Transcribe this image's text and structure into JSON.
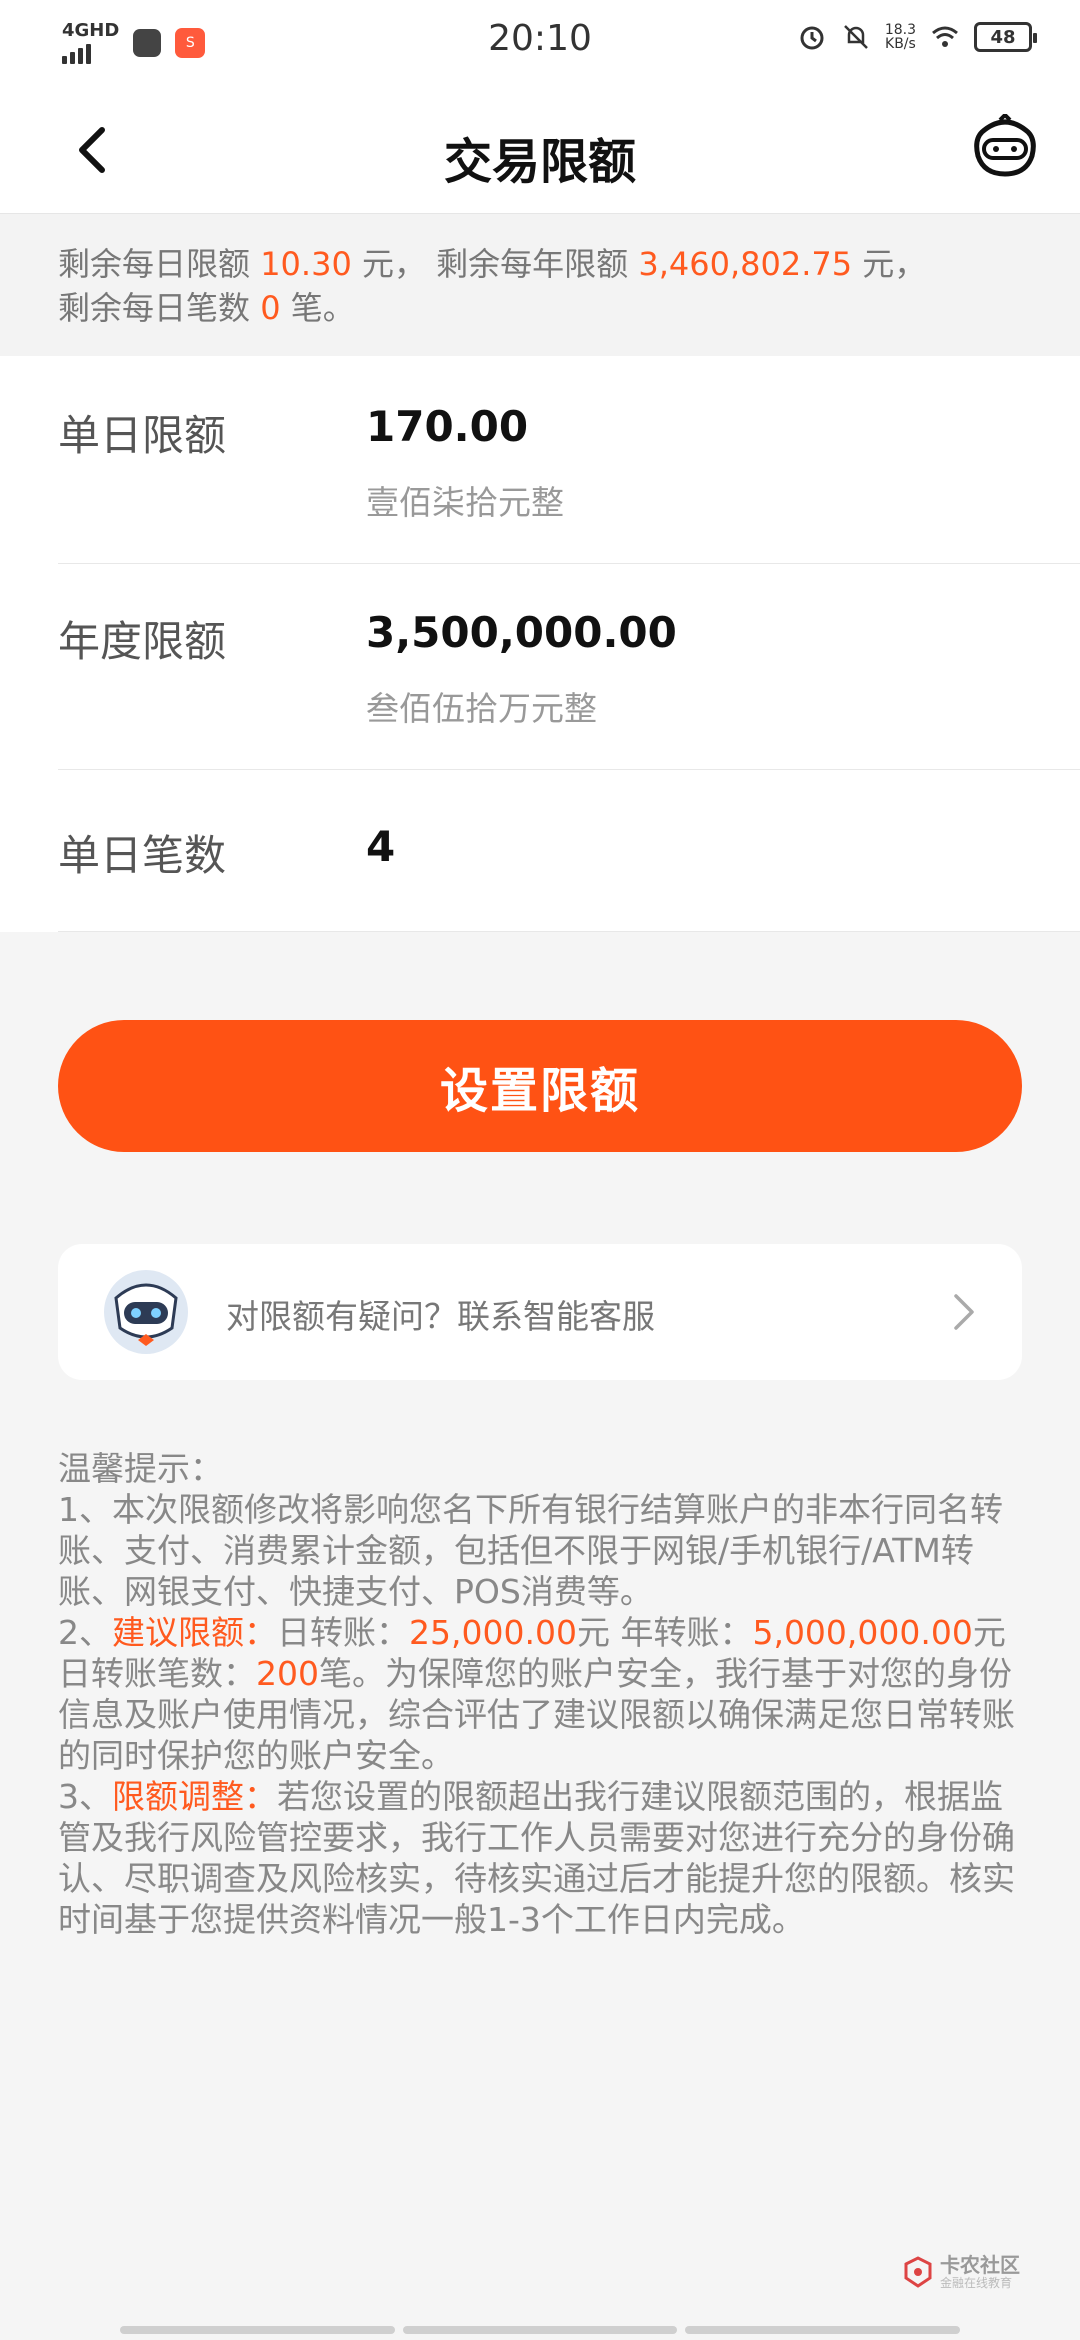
{
  "status_bar": {
    "network": "4GHD",
    "time": "20:10",
    "speed_value": "18.3",
    "speed_unit": "KB/s",
    "battery": "48",
    "app_icon_text": "S"
  },
  "header": {
    "title": "交易限额",
    "back_icon": "chevron-left-icon",
    "service_icon": "robot-service-icon"
  },
  "notice": {
    "daily_remaining_prefix": "剩余每日限额",
    "daily_remaining_value": "10.30",
    "daily_remaining_suffix": "元，",
    "yearly_remaining_prefix": "剩余每年限额",
    "yearly_remaining_value": "3,460,802.75",
    "yearly_remaining_suffix": "元，",
    "count_remaining_prefix": "剩余每日笔数",
    "count_remaining_value": "0",
    "count_remaining_suffix": "笔。"
  },
  "form": {
    "daily_limit": {
      "label": "单日限额",
      "value": "170.00",
      "words": "壹佰柒拾元整"
    },
    "yearly_limit": {
      "label": "年度限额",
      "value": "3,500,000.00",
      "words": "叁佰伍拾万元整"
    },
    "daily_count": {
      "label": "单日笔数",
      "value": "4"
    }
  },
  "primary_button": {
    "label": "设置限额"
  },
  "help": {
    "text": "对限额有疑问？联系智能客服",
    "avatar_icon": "mascot-avatar-icon",
    "chevron_icon": "chevron-right-icon"
  },
  "tips": {
    "title": "温馨提示：",
    "item1": "1、本次限额修改将影响您名下所有银行结算账户的非本行同名转账、支付、消费累计金额，包括但不限于网银/手机银行/ATM转账、网银支付、快捷支付、POS消费等。",
    "item2_prefix": "2、",
    "item2_heading": "建议限额：",
    "item2_daily_label": "日转账：",
    "item2_daily_value": "25,000.00",
    "item2_daily_unit": "元 年转账：",
    "item2_yearly_value": "5,000,000.00",
    "item2_yearly_unit": "元 日转账笔数：",
    "item2_count_value": "200",
    "item2_rest": "笔。为保障您的账户安全，我行基于对您的身份信息及账户使用情况，综合评估了建议限额以确保满足您日常转账的同时保护您的账户安全。",
    "item3_prefix": "3、",
    "item3_heading": "限额调整：",
    "item3_rest": "若您设置的限额超出我行建议限额范围的，根据监管及我行风险管控要求，我行工作人员需要对您进行充分的身份确认、尽职调查及风险核实，待核实通过后才能提升您的限额。核实时间基于您提供资料情况一般1-3个工作日内完成。"
  },
  "watermark": {
    "title": "卡农社区",
    "subtitle": "金融在线教育"
  },
  "colors": {
    "accent": "#ff5214",
    "highlight": "#ff5a1f",
    "background": "#f5f5f5"
  }
}
